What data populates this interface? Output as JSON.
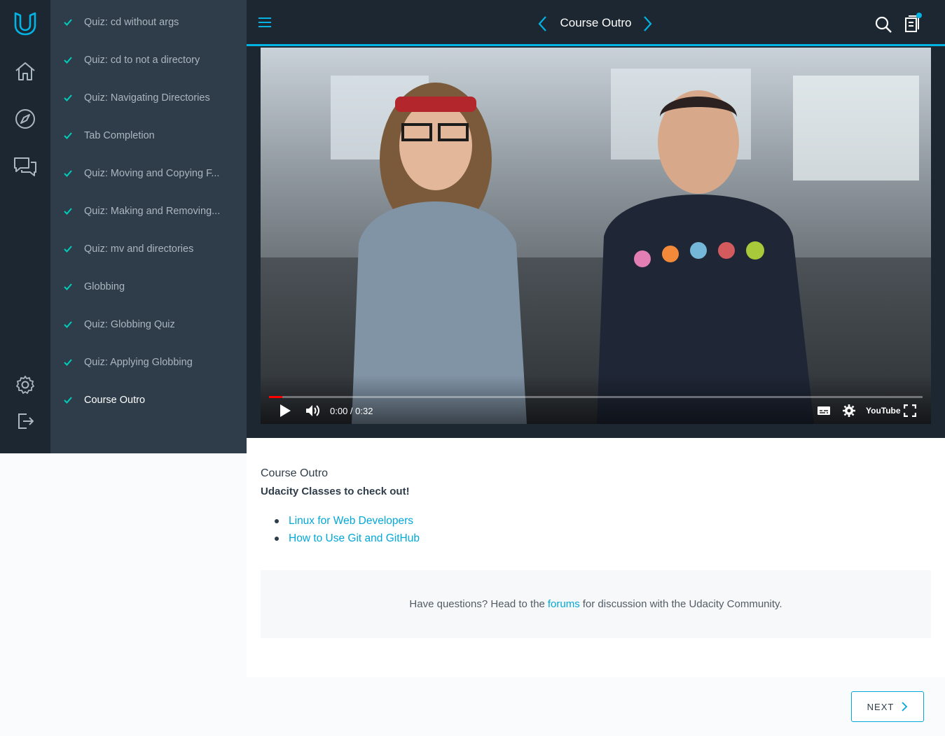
{
  "header": {
    "title": "Course Outro"
  },
  "sidebar": {
    "items": [
      {
        "label": "Quiz: cd without args"
      },
      {
        "label": "Quiz: cd to not a directory"
      },
      {
        "label": "Quiz: Navigating Directories"
      },
      {
        "label": "Tab Completion"
      },
      {
        "label": "Quiz: Moving and Copying F..."
      },
      {
        "label": "Quiz: Making and Removing..."
      },
      {
        "label": "Quiz: mv and directories"
      },
      {
        "label": "Globbing"
      },
      {
        "label": "Quiz: Globbing Quiz"
      },
      {
        "label": "Quiz: Applying Globbing"
      },
      {
        "label": "Course Outro"
      }
    ],
    "active_index": 10
  },
  "video": {
    "time": "0:00 / 0:32",
    "progress": 0.02,
    "youtube_label": "YouTube"
  },
  "content": {
    "concept_title": "Course Outro",
    "subheading": "Udacity Classes to check out!",
    "links": [
      {
        "label": "Linux for Web Developers"
      },
      {
        "label": "How to Use Git and GitHub"
      }
    ],
    "forum": {
      "before": "Have questions? Head to the",
      "link": "forums",
      "after": "for discussion with the Udacity Community."
    }
  },
  "footer": {
    "next_label": "NEXT"
  },
  "colors": {
    "accent": "#02b3e4",
    "rail": "#1d2731",
    "sidebar": "#2e3d49",
    "check": "#02ccba"
  }
}
